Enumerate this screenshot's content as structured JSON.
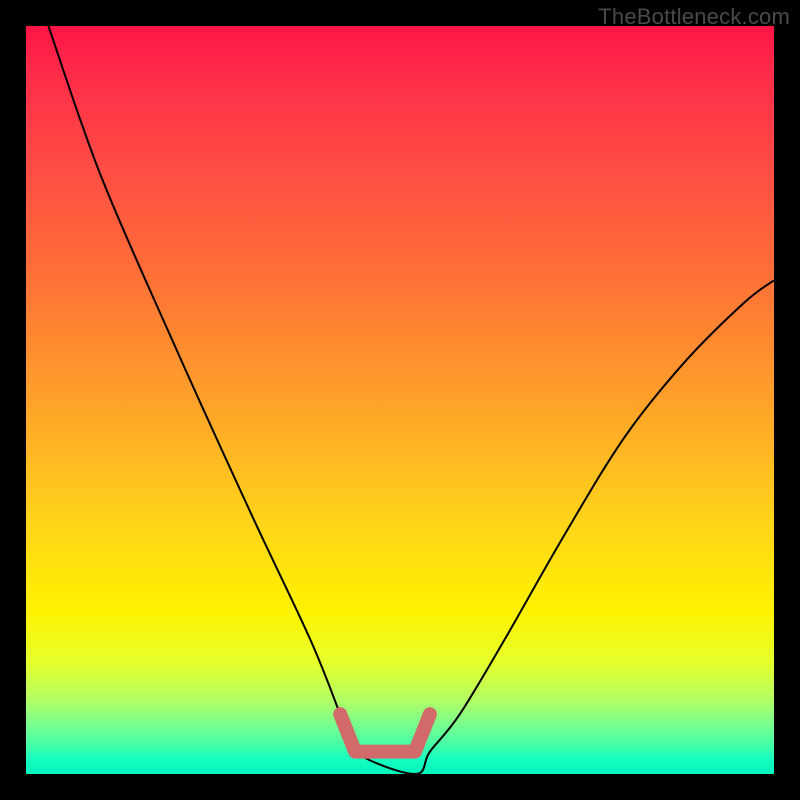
{
  "watermark": "TheBottleneck.com",
  "chart_data": {
    "type": "line",
    "title": "",
    "xlabel": "",
    "ylabel": "",
    "xlim": [
      0,
      100
    ],
    "ylim": [
      0,
      100
    ],
    "series": [
      {
        "name": "black-curve",
        "x": [
          3,
          10,
          20,
          30,
          38,
          42,
          44,
          52,
          54,
          58,
          64,
          72,
          80,
          88,
          96,
          100
        ],
        "values": [
          100,
          80,
          57,
          35,
          18,
          8,
          3,
          0,
          3,
          8,
          18,
          32,
          45,
          55,
          63,
          66
        ]
      },
      {
        "name": "salmon-bracket",
        "x": [
          42,
          44,
          52,
          54
        ],
        "values": [
          8,
          3,
          3,
          8
        ]
      }
    ],
    "styles": {
      "black-curve": {
        "stroke": "#000000",
        "stroke_width": 2,
        "fill": "none"
      },
      "salmon-bracket": {
        "stroke": "#d36a6a",
        "stroke_width": 14,
        "fill": "none",
        "linecap": "round",
        "linejoin": "round"
      }
    },
    "background_gradient": {
      "direction": "vertical",
      "stops": [
        {
          "pos": 0.0,
          "color": "#ff1446"
        },
        {
          "pos": 0.5,
          "color": "#ffa12a"
        },
        {
          "pos": 0.78,
          "color": "#fff200"
        },
        {
          "pos": 1.0,
          "color": "#00f5bd"
        }
      ]
    }
  }
}
